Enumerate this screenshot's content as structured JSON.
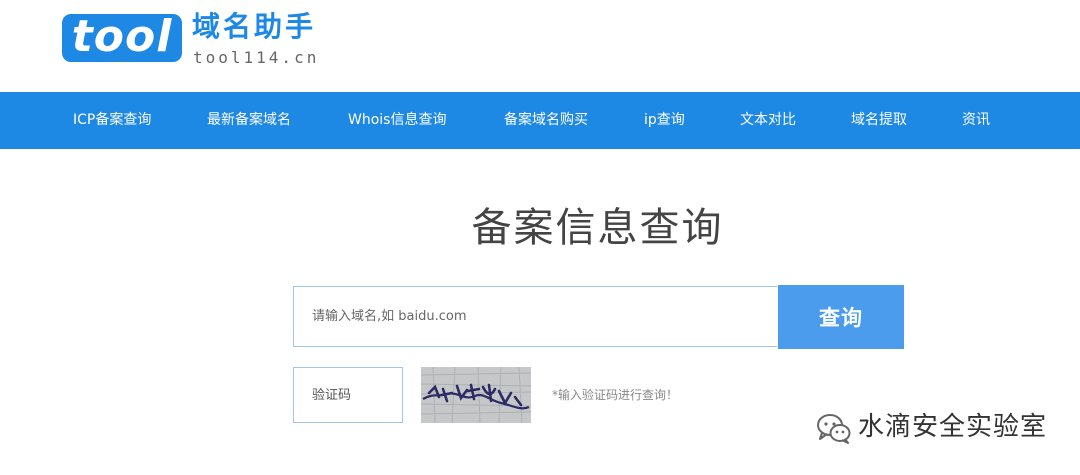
{
  "logo": {
    "badge": "tool",
    "title": "域名助手",
    "domain": "tool114.cn"
  },
  "nav": [
    {
      "label": "ICP备案查询"
    },
    {
      "label": "最新备案域名"
    },
    {
      "label": "Whois信息查询"
    },
    {
      "label": "备案域名购买"
    },
    {
      "label": "ip查询"
    },
    {
      "label": "文本对比"
    },
    {
      "label": "域名提取"
    },
    {
      "label": "资讯"
    }
  ],
  "main": {
    "title": "备案信息查询",
    "search": {
      "placeholder": "请输入域名,如 baidu.com",
      "value": "",
      "button_label": "查询"
    },
    "captcha": {
      "placeholder": "验证码",
      "value": "",
      "hint": "*输入验证码进行查询！"
    }
  },
  "watermark": {
    "icon": "wechat-icon",
    "text": "水滴安全实验室"
  },
  "colors": {
    "brand": "#1e88e5",
    "button": "#4b9cec"
  }
}
